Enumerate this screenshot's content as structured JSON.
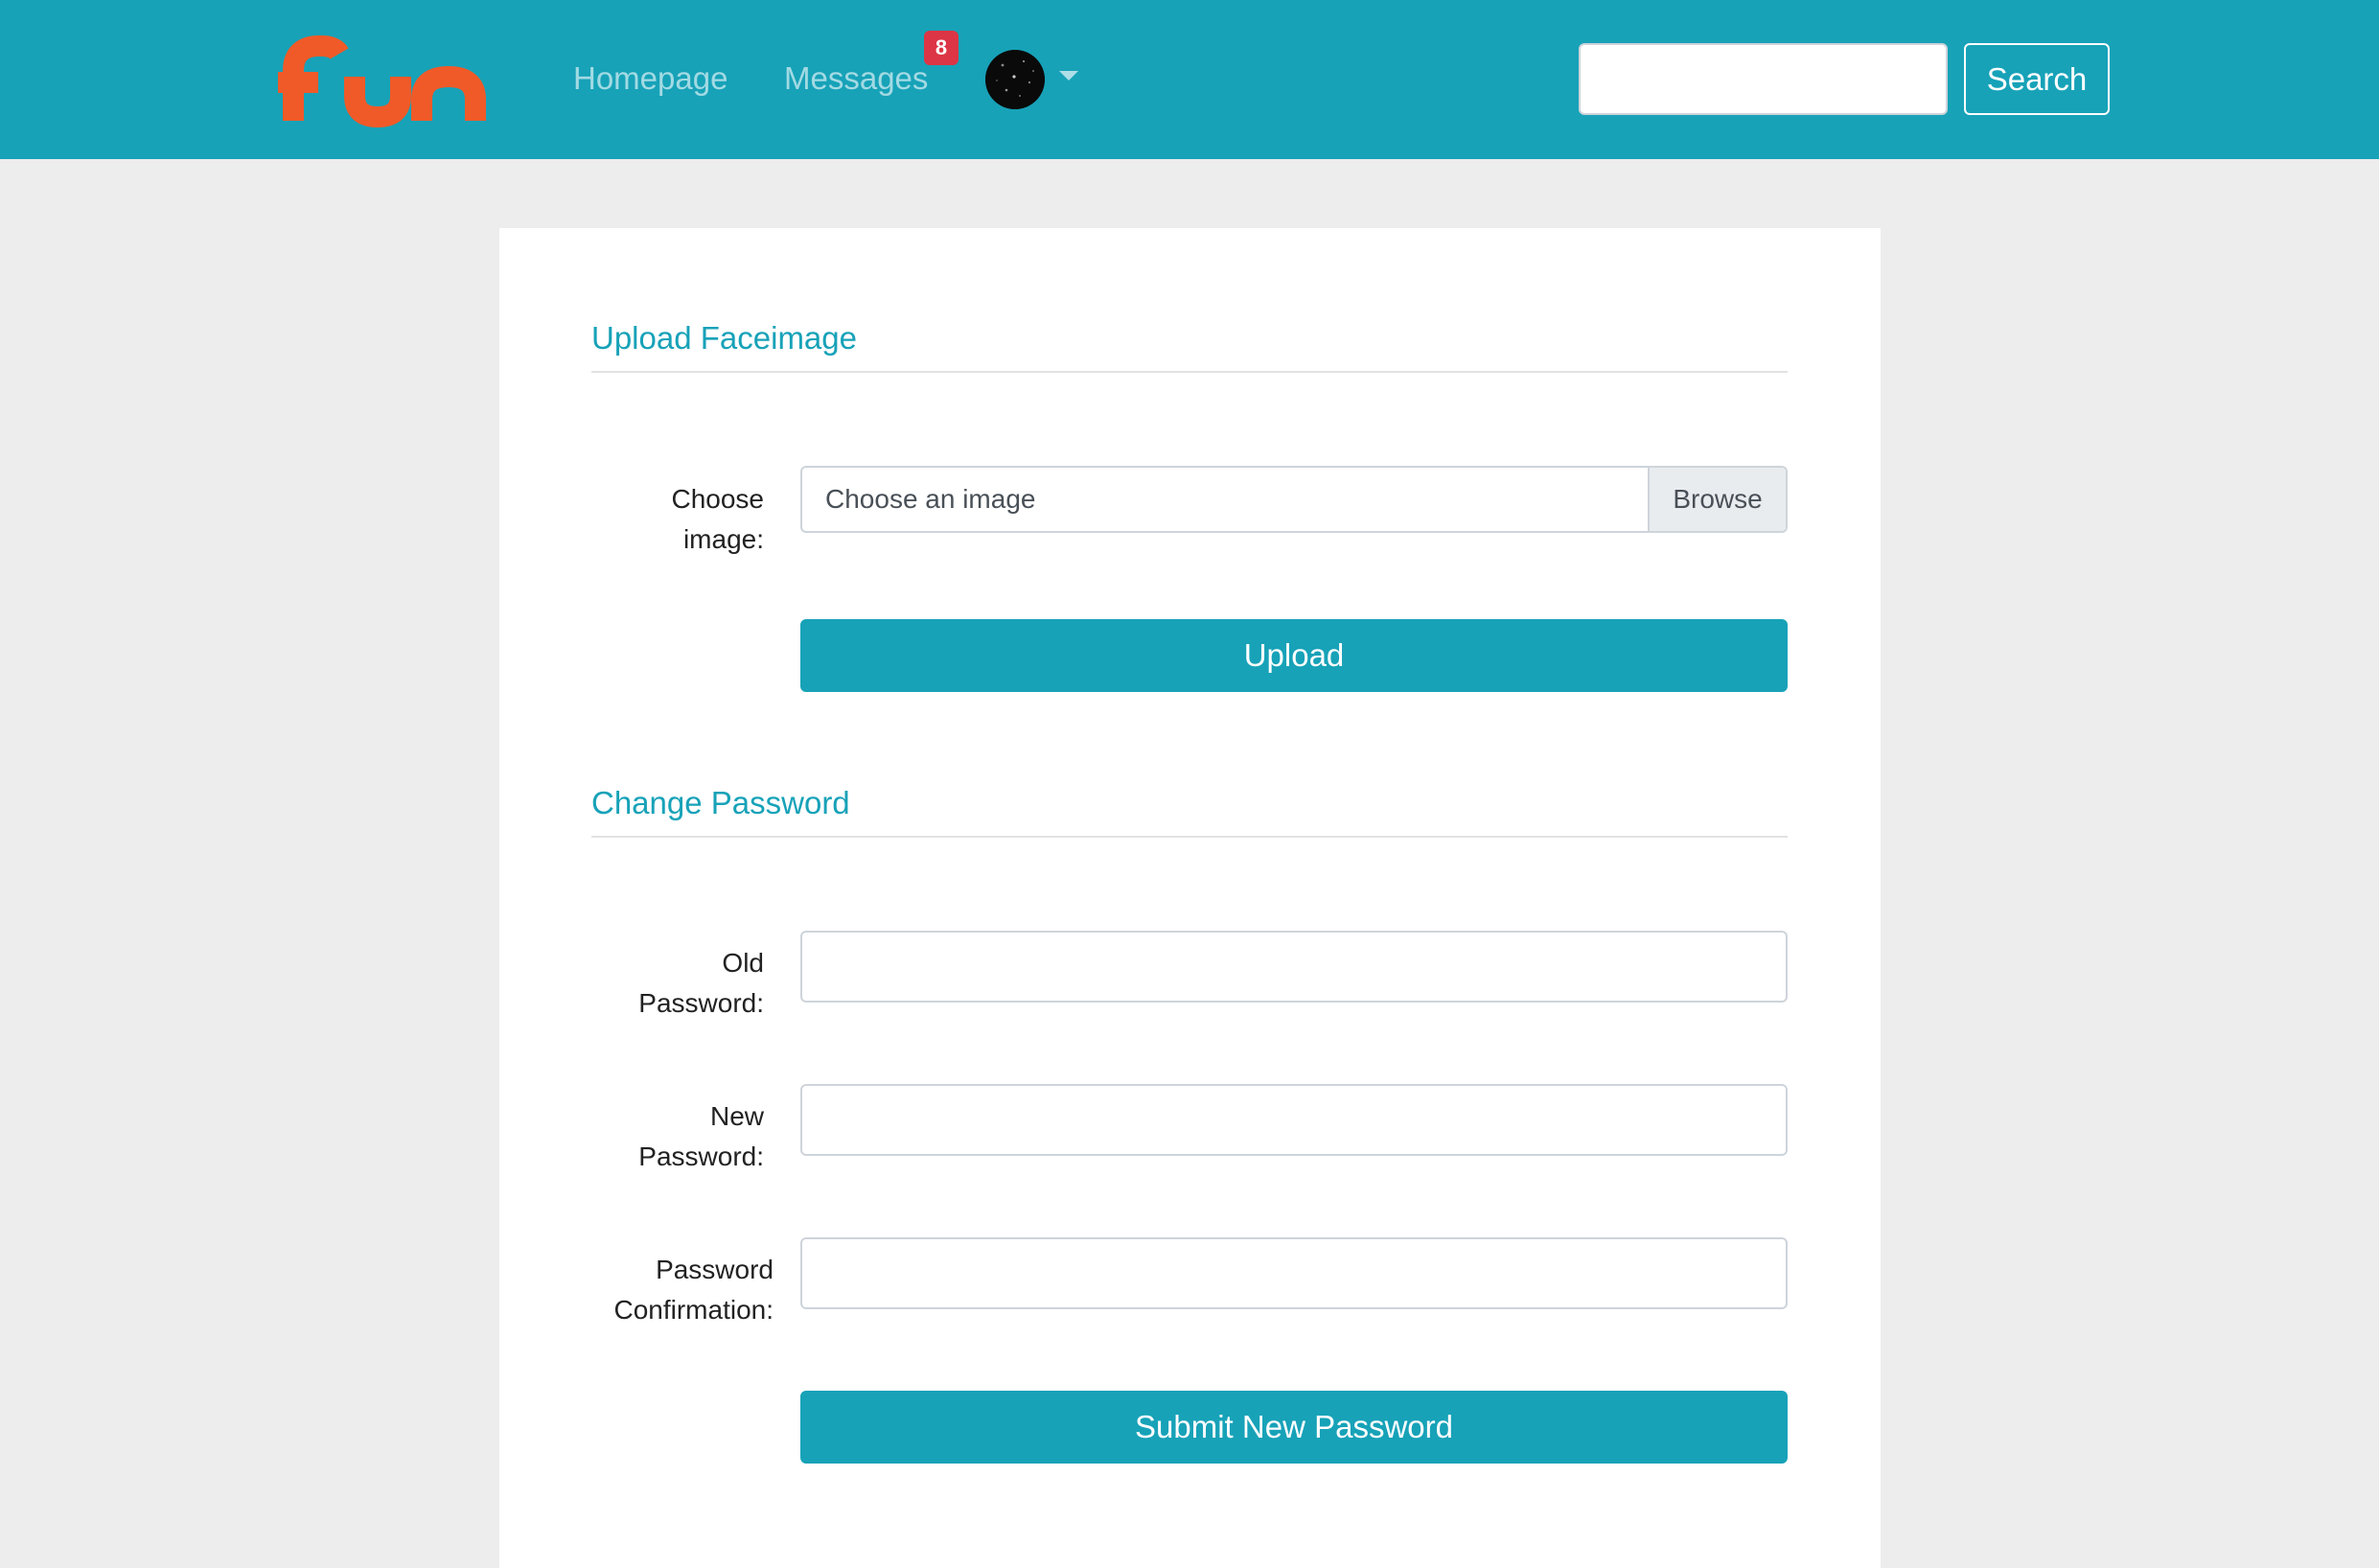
{
  "brand": {
    "logo_text": "fun",
    "logo_color": "#f05a28"
  },
  "nav": {
    "homepage_label": "Homepage",
    "messages_label": "Messages",
    "messages_badge": "8",
    "avatar_icon": "user-avatar",
    "dropdown_icon": "caret-down-icon"
  },
  "search": {
    "placeholder": "",
    "button_label": "Search"
  },
  "upload_section": {
    "title": "Upload Faceimage",
    "choose_label_line1": "Choose",
    "choose_label_line2": "image:",
    "file_placeholder": "Choose an image",
    "browse_label": "Browse",
    "upload_button": "Upload"
  },
  "password_section": {
    "title": "Change Password",
    "old_label_line1": "Old",
    "old_label_line2": "Password:",
    "new_label_line1": "New",
    "new_label_line2": "Password:",
    "confirm_label_line1": "Password",
    "confirm_label_line2": "Confirmation:",
    "submit_button": "Submit New Password"
  },
  "colors": {
    "accent": "#17a2b8",
    "badge": "#dc3545",
    "background": "#ededed"
  }
}
